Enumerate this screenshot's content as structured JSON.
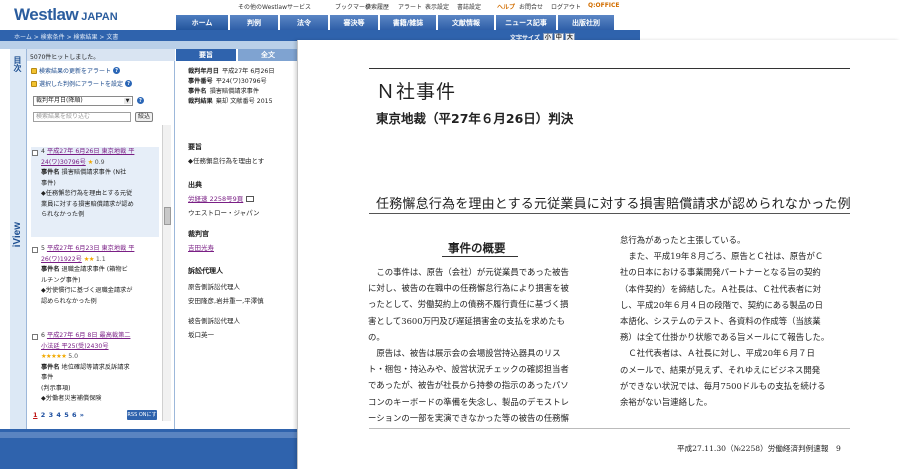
{
  "header": {
    "logo": "Westlaw",
    "logo_sub": "JAPAN",
    "util_links": [
      "その他のWestlawサービス",
      "ブックマーク",
      "検索履歴",
      "アラート",
      "表示設定",
      "書誌設定",
      "ヘルプ",
      "お問合せ",
      "ログアウト"
    ],
    "nav_tabs": [
      "ホーム",
      "判例",
      "法令",
      "審決等",
      "書籍/雑誌",
      "文献情報",
      "ニュース記事",
      "出版社別"
    ],
    "breadcrumb": "ホーム > 検索条件 > 検索結果 > 文書",
    "font_size_label": "文字サイズ",
    "font_sizes": [
      "小",
      "中",
      "大"
    ]
  },
  "side_tabs": {
    "toc": "目次",
    "iview": "iView"
  },
  "results": {
    "count": "5070件ヒットしました。",
    "alert_update": "検索結果の更新をアラート",
    "alert_selected": "選択した判例にアラートを設定",
    "sort_value": "裁判年月日(降順)",
    "search_placeholder": "検索結果を絞り込む",
    "narrow_button": "絞込",
    "items": [
      {
        "num": "4",
        "link1": "平成27年 6月26日 東京地裁 平",
        "link2": "24(ワ)30796号",
        "stars": "★",
        "score": "0.9",
        "case_label": "事件名",
        "case_name": "損害賠償請求事件 (N社",
        "case_name2": "事件)",
        "snippet1": "◆任務懈怠行為を理由とする元従",
        "snippet2": "業員に対する損害賠償請求が認め",
        "snippet3": "られなかった例"
      },
      {
        "num": "5",
        "link1": "平成27年 6月23日 東京地裁 平",
        "link2": "26(ワ)1922号",
        "stars": "★★",
        "score": "1.1",
        "case_label": "事件名",
        "case_name": "退職金請求事件 (箱物ビ",
        "case_name2": "ルチング事件)",
        "snippet1": "◆労使慣行に基づく退職金請求が",
        "snippet2": "認められなかった例"
      },
      {
        "num": "6",
        "link1": "平成27年 6月 8日 最高裁第二",
        "link2": "小法廷 平25(受)2430号",
        "stars": "★★★★★",
        "score": "5.0",
        "case_label": "事件名",
        "case_name": "地位確認等請求反訴請求",
        "case_name2": "事件",
        "snippet1": "(判示事項)",
        "snippet2": "◆労働者災害補償保険"
      }
    ],
    "pages": [
      "1",
      "2",
      "3",
      "4",
      "5",
      "6",
      "»"
    ],
    "on_button": "RSS ONにする"
  },
  "detail": {
    "tabs": [
      "要旨",
      "全文"
    ],
    "meta": [
      {
        "label": "裁判年月日",
        "value": "平成27年 6月26日"
      },
      {
        "label": "事件番号",
        "value": "平24(ワ)30796号"
      },
      {
        "label": "事件名",
        "value": "損害賠償請求事件"
      },
      {
        "label": "裁判結果",
        "value": "棄却  文献番号  2015"
      }
    ],
    "summary_head": "要旨",
    "summary_text": "◆任務懈怠行為を理由とす",
    "source_head": "出典",
    "source_link": "労経速 2258号9頁",
    "source_pub": "ウエストロー・ジャパン",
    "judge_head": "裁判官",
    "judge_name": "吉田光寿",
    "counsel_head": "訴訟代理人",
    "counsel_plaintiff_label": "原告側訴訟代理人",
    "counsel_plaintiff": "安田隆彦,岩井重一,平澤慎",
    "counsel_defendant_label": "被告側訴訟代理人",
    "counsel_defendant": "坂口英一"
  },
  "viewer": {
    "title": "Ｎ社事件",
    "court": "東京地裁（平27年６月26日）判決",
    "issue": "任務懈怠行為を理由とする元従業員に対する損害賠償請求が認められなかった例",
    "summary_head": "事件の概要",
    "col_left": [
      "　この事件は、原告（会社）が元従業員であった被告",
      "に対し、被告の在職中の任務懈怠行為により損害を被",
      "ったとして、労働契約上の債務不履行責任に基づく損",
      "害として3600万円及び遅延損害金の支払を求めたも",
      "の。",
      "　原告は、被告は展示会の会場設営持込器具のリス",
      "ト・梱包・持込みや、設営状況チェックの確認担当者",
      "であったが、被告が社長から持参の指示のあったパソ",
      "コンのキーボードの準備を失念し、製品のデモストレ",
      "ーションの一部を実演できなかった等の被告の任務懈"
    ],
    "col_right": [
      "怠行為があったと主張している。",
      "　また、平成19年８月ごろ、原告とＣ社は、原告がＣ",
      "社の日本における事業開発パートナーとなる旨の契約",
      "（本件契約）を締結した。Ａ社長は、Ｃ社代表者に対",
      "し、平成20年６月４日の段階で、契約にある製品の日",
      "本語化、システムのテスト、各資料の作成等（当該業",
      "務）は全て仕掛かり状態である旨メールにて報告した。",
      "　Ｃ社代表者は、Ａ社長に対し、平成20年６月７日",
      "のメールで、結果が見えず、それゆえにビジネス開発",
      "ができない状況では、毎月7500ドルもの支払を続ける",
      "余裕がない旨連絡した。"
    ],
    "footer": "平成27.11.30（№2258）労働経済判例速報　9"
  }
}
